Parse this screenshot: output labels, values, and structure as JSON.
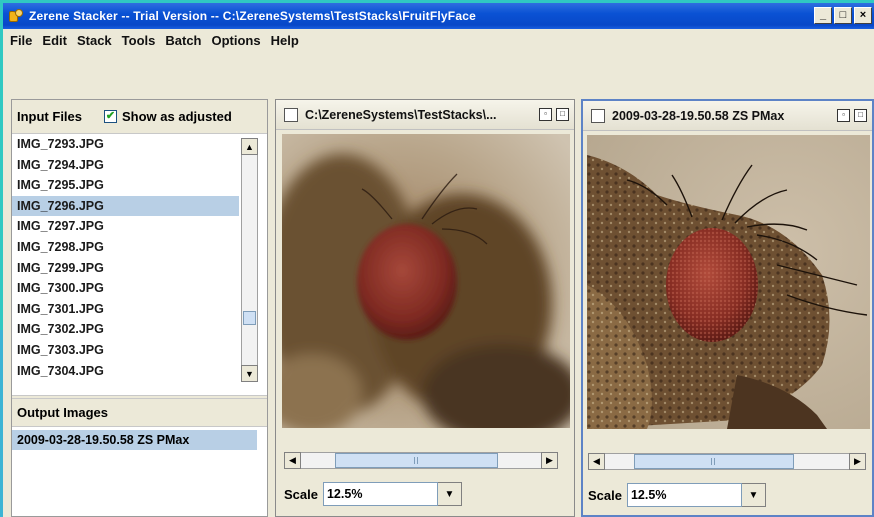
{
  "window": {
    "title": "Zerene Stacker -- Trial Version -- C:\\ZereneSystems\\TestStacks\\FruitFlyFace",
    "buttons": [
      "_",
      "□",
      "×"
    ]
  },
  "menu": [
    "File",
    "Edit",
    "Stack",
    "Tools",
    "Batch",
    "Options",
    "Help"
  ],
  "input_files": {
    "header": "Input Files",
    "show_adjusted_label": "Show as adjusted",
    "show_adjusted_checked": true,
    "files": [
      "IMG_7293.JPG",
      "IMG_7294.JPG",
      "IMG_7295.JPG",
      "IMG_7296.JPG",
      "IMG_7297.JPG",
      "IMG_7298.JPG",
      "IMG_7299.JPG",
      "IMG_7300.JPG",
      "IMG_7301.JPG",
      "IMG_7302.JPG",
      "IMG_7303.JPG",
      "IMG_7304.JPG"
    ],
    "selected_index": 3
  },
  "output_images": {
    "header": "Output Images",
    "items": [
      "2009-03-28-19.50.58 ZS PMax"
    ]
  },
  "frame_left": {
    "title": "C:\\ZereneSystems\\TestStacks\\...",
    "scale_label": "Scale",
    "scale_value": "12.5%"
  },
  "frame_right": {
    "title": "2009-03-28-19.50.58 ZS PMax",
    "scale_label": "Scale",
    "scale_value": "12.5%"
  },
  "icons": {
    "scroll_up": "▲",
    "scroll_down": "▼",
    "scroll_left": "◀",
    "scroll_right": "▶",
    "dropdown": "▼",
    "check": "✔"
  }
}
